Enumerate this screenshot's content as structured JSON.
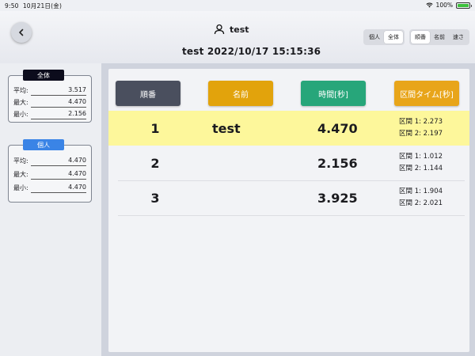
{
  "status_bar": {
    "time": "9:50",
    "date": "10月21日(金)",
    "battery": "100%"
  },
  "header": {
    "user_name": "test",
    "subtitle": "test  2022/10/17 15:15:36",
    "scope_options": [
      "個人",
      "全体"
    ],
    "scope_selected": "全体",
    "sort_options": [
      "順番",
      "名前",
      "速さ"
    ],
    "sort_selected": "順番"
  },
  "stats": {
    "overall": {
      "title": "全体",
      "rows": [
        {
          "label": "平均:",
          "value": "3.517"
        },
        {
          "label": "最大:",
          "value": "4.470"
        },
        {
          "label": "最小:",
          "value": "2.156"
        }
      ]
    },
    "individual": {
      "title": "個人",
      "rows": [
        {
          "label": "平均:",
          "value": "4.470"
        },
        {
          "label": "最大:",
          "value": "4.470"
        },
        {
          "label": "最小:",
          "value": "4.470"
        }
      ]
    }
  },
  "table": {
    "headers": [
      "順番",
      "名前",
      "時間[秒]",
      "区間タイム[秒]"
    ],
    "rows": [
      {
        "rank": "1",
        "name": "test",
        "time": "4.470",
        "splits": [
          "区間 1: 2.273",
          "区間 2: 2.197"
        ]
      },
      {
        "rank": "2",
        "name": "",
        "time": "2.156",
        "splits": [
          "区間 1: 1.012",
          "区間 2: 1.144"
        ]
      },
      {
        "rank": "3",
        "name": "",
        "time": "3.925",
        "splits": [
          "区間 1: 1.904",
          "区間 2: 2.021"
        ]
      }
    ]
  },
  "colors": {
    "header_order": "#4a4f5e",
    "header_name": "#e2a30c",
    "header_time": "#27a67a",
    "header_splits": "#e8a51a",
    "highlight_row": "#fdf79b",
    "overall_badge": "#0c0c1c",
    "individual_badge": "#3a84e6"
  }
}
